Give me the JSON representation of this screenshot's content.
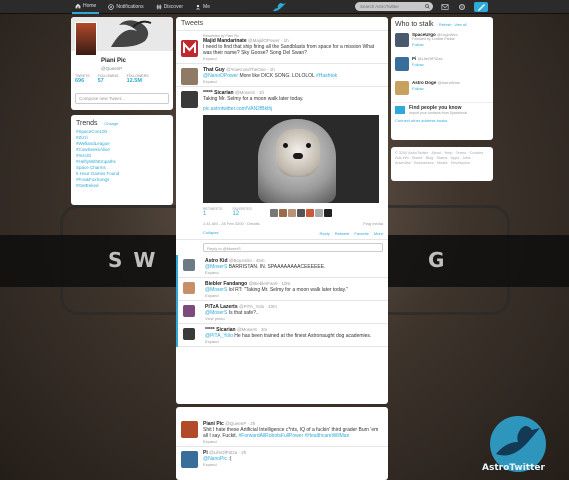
{
  "nav": {
    "home": "Home",
    "notifications": "Notifications",
    "discover": "Discover",
    "me": "Me"
  },
  "search": {
    "placeholder": "Search AstroTwitter"
  },
  "profile": {
    "name": "Piani Pic",
    "handle": "@QueenP",
    "tweets_label": "TWEETS",
    "tweets": "696",
    "following_label": "FOLLOWING",
    "following": "57",
    "followers_label": "FOLLOWERS",
    "followers": "12.5M",
    "compose_placeholder": "Compose new Tweet..."
  },
  "trends": {
    "title": "Trends",
    "change": "· Change",
    "items": [
      "#SpaceCon100",
      "#Zizzi",
      "#WellandLeague",
      "#CowSeeksAlive",
      "#InsIJG",
      "#HeftyWithEmpaths",
      "Space Charms",
      "5 Hour Games Found",
      "#Fox&FoxSongs",
      "#GetEeked"
    ]
  },
  "timeline": {
    "title": "Tweets",
    "promo": "Retweeted by Piani Pic",
    "tweets": [
      {
        "name": "Majid Mandarinate",
        "handle": "@MajidOPower · 1h",
        "text": "I need to find that ship firing all the Sandblasts from space for a mission What was their name? Sky Goose? Song Del Swan?",
        "expand": "Expand"
      },
      {
        "name": "That Guy",
        "handle": "@YouKnowTheOne · 1h",
        "text_link": "@NanoOPower",
        "text": " More like DICK SONG. LOLOLOL",
        "text_tag": " #Hashtok",
        "expand": "Expand"
      }
    ],
    "main": {
      "name": "***** Sicarian",
      "handle": "@MoserS · 1h",
      "text": "Taking Mr. Selmy for a moon walk later today.",
      "link": "pic.astrotwitter.com/VAN2fBkthj",
      "retweets_label": "RETWEETS",
      "retweets": "1",
      "favorites_label": "FAVORITES",
      "favorites": "12",
      "time": "1:41 AM - 28 Feb 3200 · Details",
      "flag": "Flag media",
      "collapse": "Collapse",
      "reply": "Reply",
      "retweet": "Retweet",
      "favorite": "Favorite",
      "more": "More",
      "reply_placeholder": "Reply to @MoserS"
    },
    "replies": [
      {
        "name": "Astro Kid",
        "handle": "@BoyAstro · 45m",
        "link": "@MoserS",
        "text": " BARRISTAN. IN. SPAAAAAAAACEEEEEE.",
        "expand": "Expand"
      },
      {
        "name": "Biebler Fandango",
        "handle": "@BieblerFan0 · 10m",
        "link": "@MoserS",
        "text": " lol RT: \"Taking Mr. Selmy for a moon walk later today.\"",
        "expand": "Expand"
      },
      {
        "name": "PiTzA Lazerts",
        "handle": "@PiTA_Yolo · 10m",
        "link": "@MoserS",
        "text": " Is that safe?..",
        "expand": "View photo"
      },
      {
        "name": "***** Sicarian",
        "handle": "@MoserS · 3m",
        "link": "@PiTA_Yolo",
        "text": " He has been trained at the finest Astronaught dog academies.",
        "expand": "Expand"
      }
    ],
    "later": [
      {
        "name": "Piani Pic",
        "handle": "@QueenP · 2h",
        "text": "Shit I hate these Artificial Intelligence c*nts, IQ of a fuckin' third grader Burn 'em all I say. Fuckit.",
        "tags": " #ForwardAllRobotsFullPower #HealthcareWillMan",
        "expand": "Expand"
      },
      {
        "name": "Pi",
        "handle": "@LifeOfPiZza · 2h",
        "link": "@NanoPic",
        "text": " :(",
        "expand": "Expand"
      }
    ]
  },
  "who": {
    "title": "Who to stalk",
    "links": "· Refresh · View all",
    "suggestions": [
      {
        "name": "SpaceUrgo",
        "handle": "@UrgoWev",
        "sub": "Followed by Zombie Panda",
        "follow": "Follow"
      },
      {
        "name": "Pi",
        "handle": "@LifeOfPiZza",
        "sub": "",
        "follow": "Follow"
      },
      {
        "name": "Astro Doge",
        "handle": "@AstroWow",
        "sub": "",
        "follow": "Follow"
      }
    ],
    "find_title": "Find people you know",
    "find_sub": "Import your contacts from Spacebook",
    "connect": "Connect other address books"
  },
  "footer": {
    "text": "© 3200 AstroTwitter · About · Help · Terms · Cookies · Ads info · Brand · Blog · Status · Apps · Jobs · Advertise · Businesses · Media · Developers"
  },
  "background": {
    "letter_left": "S W",
    "letter_right": "G"
  },
  "brand": {
    "name": "AstroTwitter"
  },
  "colors": {
    "accent": "#2fa9d8",
    "topbar": "#2b2b2b"
  }
}
